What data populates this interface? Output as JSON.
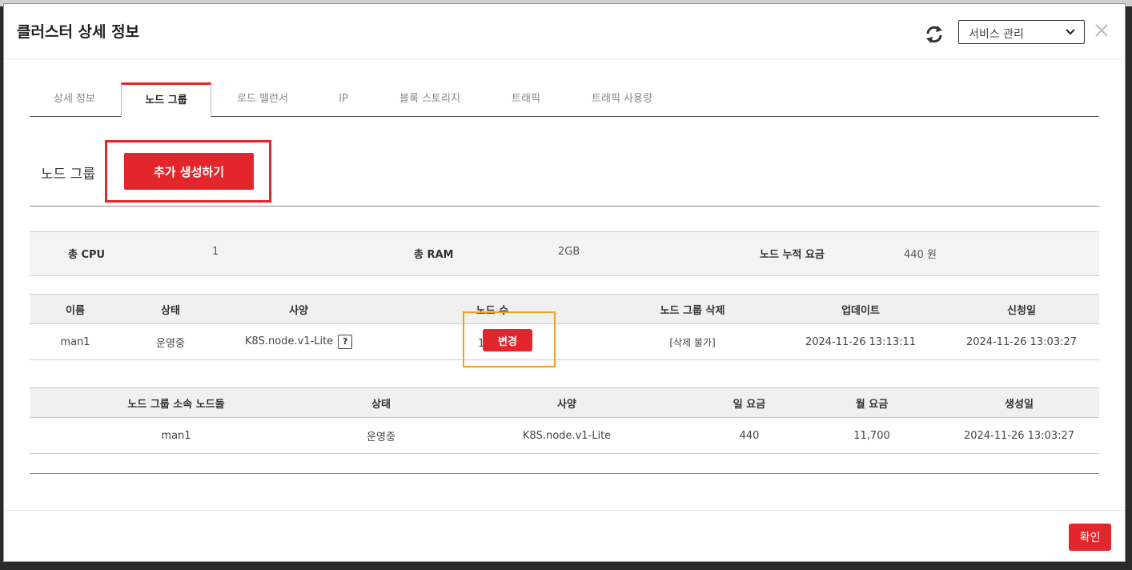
{
  "modal": {
    "title": "클러스터 상세 정보"
  },
  "header": {
    "service_select": {
      "value": "서비스 관리"
    }
  },
  "tabs": [
    {
      "label": "상세 정보"
    },
    {
      "label": "노드 그룹",
      "active": true
    },
    {
      "label": "로드 밸런서"
    },
    {
      "label": "IP"
    },
    {
      "label": "블록 스토리지"
    },
    {
      "label": "트래픽"
    },
    {
      "label": "트래픽 사용량"
    }
  ],
  "section": {
    "title": "노드 그룹",
    "add_button": "추가 생성하기"
  },
  "summary": {
    "cpu_label": "총 CPU",
    "cpu_value": "1",
    "ram_label": "총 RAM",
    "ram_value": "2GB",
    "fee_label": "노드 누적 요금",
    "fee_value": "440 원"
  },
  "node_group_table": {
    "headers": [
      "이름",
      "상태",
      "사양",
      "노드 수",
      "노드 그룹 삭제",
      "업데이트",
      "신청일"
    ],
    "rows": [
      {
        "name": "man1",
        "status": "운영중",
        "spec": "K8S.node.v1-Lite",
        "spec_help": "?",
        "node_count": "1개",
        "change_button": "변경",
        "delete": "[삭제 불가]",
        "updated": "2024-11-26 13:13:11",
        "requested": "2024-11-26 13:03:27"
      }
    ]
  },
  "nodes_table": {
    "headers": [
      "노드 그룹 소속 노드들",
      "상태",
      "사양",
      "일 요금",
      "월 요금",
      "생성일"
    ],
    "rows": [
      {
        "name": "man1",
        "status": "운영중",
        "spec": "K8S.node.v1-Lite",
        "daily": "440",
        "monthly": "11,700",
        "created": "2024-11-26 13:03:27"
      }
    ]
  },
  "footer": {
    "confirm_button": "확인"
  },
  "colors": {
    "accent": "#e2262b",
    "highlight_orange": "#f0a020"
  }
}
